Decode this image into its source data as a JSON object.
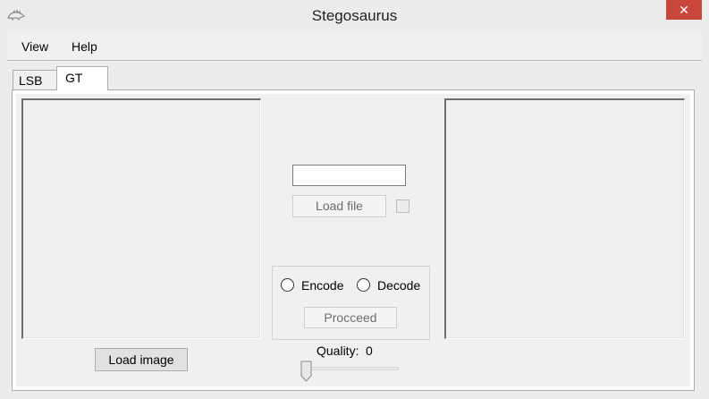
{
  "window": {
    "title": "Stegosaurus",
    "close_glyph": "✕"
  },
  "menu": {
    "items": [
      {
        "label": "View"
      },
      {
        "label": "Help"
      }
    ]
  },
  "tabs": [
    {
      "label": "LSB",
      "active": false
    },
    {
      "label": "GT",
      "active": true
    }
  ],
  "left_panel": {
    "load_image_label": "Load image"
  },
  "center": {
    "file_input": {
      "value": "",
      "placeholder": ""
    },
    "load_file_label": "Load file",
    "load_file_enabled": false,
    "checkbox_checked": false,
    "mode": {
      "options": [
        {
          "label": "Encode",
          "selected": false
        },
        {
          "label": "Decode",
          "selected": false
        }
      ],
      "proceed_label": "Procceed",
      "proceed_enabled": false
    },
    "quality": {
      "label": "Quality:",
      "value": "0"
    }
  },
  "colors": {
    "close_button": "#c9463d",
    "window_background": "#ececec",
    "panel_background": "#f0f0f0"
  },
  "icons": {
    "app": "stegosaurus-icon",
    "close": "close-icon",
    "slider": "slider-thumb-icon"
  }
}
